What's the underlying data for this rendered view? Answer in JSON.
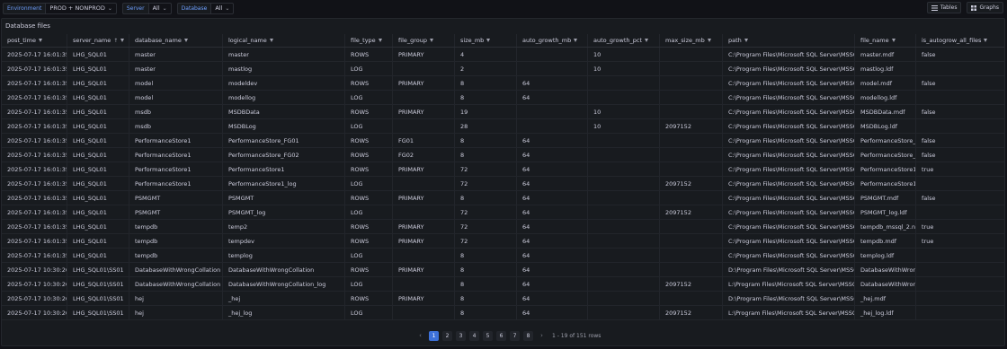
{
  "variables": [
    {
      "label": "Environment",
      "value": "PROD + NONPROD",
      "chevron": true
    },
    {
      "label": "Server",
      "value": "All",
      "chevron": true
    },
    {
      "label": "Database",
      "value": "All",
      "chevron": true
    }
  ],
  "toolbar_buttons": [
    {
      "label": "Tables",
      "icon": "list-icon"
    },
    {
      "label": "Graphs",
      "icon": "grid-icon"
    }
  ],
  "panel": {
    "title": "Database files"
  },
  "table": {
    "columns": [
      "post_time",
      "server_name",
      "database_name",
      "logical_name",
      "file_type",
      "file_group",
      "size_mb",
      "auto_growth_mb",
      "auto_growth_pct",
      "max_size_mb",
      "path",
      "file_name",
      "is_autogrow_all_files"
    ],
    "sorted_column": "server_name",
    "sort_direction": "asc",
    "rows": [
      [
        "2025-07-17 16:01:35",
        "LHG_SQL01",
        "master",
        "master",
        "ROWS",
        "PRIMARY",
        "4",
        "",
        "10",
        "",
        "C:\\Program Files\\Microsoft SQL Server\\MSSQL1!",
        "master.mdf",
        "false"
      ],
      [
        "2025-07-17 16:01:35",
        "LHG_SQL01",
        "master",
        "mastlog",
        "LOG",
        "",
        "2",
        "",
        "10",
        "",
        "C:\\Program Files\\Microsoft SQL Server\\MSSQL1!",
        "mastlog.ldf",
        ""
      ],
      [
        "2025-07-17 16:01:35",
        "LHG_SQL01",
        "model",
        "modeldev",
        "ROWS",
        "PRIMARY",
        "8",
        "64",
        "",
        "",
        "C:\\Program Files\\Microsoft SQL Server\\MSSQL1!",
        "model.mdf",
        "false"
      ],
      [
        "2025-07-17 16:01:35",
        "LHG_SQL01",
        "model",
        "modellog",
        "LOG",
        "",
        "8",
        "64",
        "",
        "",
        "C:\\Program Files\\Microsoft SQL Server\\MSSQL1!",
        "modellog.ldf",
        ""
      ],
      [
        "2025-07-17 16:01:35",
        "LHG_SQL01",
        "msdb",
        "MSDBData",
        "ROWS",
        "PRIMARY",
        "19",
        "",
        "10",
        "",
        "C:\\Program Files\\Microsoft SQL Server\\MSSQL1!",
        "MSDBData.mdf",
        "false"
      ],
      [
        "2025-07-17 16:01:35",
        "LHG_SQL01",
        "msdb",
        "MSDBLog",
        "LOG",
        "",
        "28",
        "",
        "10",
        "2097152",
        "C:\\Program Files\\Microsoft SQL Server\\MSSQL1!",
        "MSDBLog.ldf",
        ""
      ],
      [
        "2025-07-17 16:01:35",
        "LHG_SQL01",
        "PerformanceStore1",
        "PerformanceStore_FG01",
        "ROWS",
        "FG01",
        "8",
        "64",
        "",
        "",
        "C:\\Program Files\\Microsoft SQL Server\\MSSQL1!",
        "PerformanceStore_FG",
        "false"
      ],
      [
        "2025-07-17 16:01:35",
        "LHG_SQL01",
        "PerformanceStore1",
        "PerformanceStore_FG02",
        "ROWS",
        "FG02",
        "8",
        "64",
        "",
        "",
        "C:\\Program Files\\Microsoft SQL Server\\MSSQL1!",
        "PerformanceStore_FG",
        "false"
      ],
      [
        "2025-07-17 16:01:35",
        "LHG_SQL01",
        "PerformanceStore1",
        "PerformanceStore1",
        "ROWS",
        "PRIMARY",
        "72",
        "64",
        "",
        "",
        "C:\\Program Files\\Microsoft SQL Server\\MSSQL1!",
        "PerformanceStore1.m",
        "true"
      ],
      [
        "2025-07-17 16:01:35",
        "LHG_SQL01",
        "PerformanceStore1",
        "PerformanceStore1_log",
        "LOG",
        "",
        "72",
        "64",
        "",
        "2097152",
        "C:\\Program Files\\Microsoft SQL Server\\MSSQL1!",
        "PerformanceStore1_lo",
        ""
      ],
      [
        "2025-07-17 16:01:35",
        "LHG_SQL01",
        "PSMGMT",
        "PSMGMT",
        "ROWS",
        "PRIMARY",
        "8",
        "64",
        "",
        "",
        "C:\\Program Files\\Microsoft SQL Server\\MSSQL1!",
        "PSMGMT.mdf",
        "false"
      ],
      [
        "2025-07-17 16:01:35",
        "LHG_SQL01",
        "PSMGMT",
        "PSMGMT_log",
        "LOG",
        "",
        "72",
        "64",
        "",
        "2097152",
        "C:\\Program Files\\Microsoft SQL Server\\MSSQL1!",
        "PSMGMT_log.ldf",
        ""
      ],
      [
        "2025-07-17 16:01:35",
        "LHG_SQL01",
        "tempdb",
        "temp2",
        "ROWS",
        "PRIMARY",
        "72",
        "64",
        "",
        "",
        "C:\\Program Files\\Microsoft SQL Server\\MSSQL1!",
        "tempdb_mssql_2.ndf",
        "true"
      ],
      [
        "2025-07-17 16:01:35",
        "LHG_SQL01",
        "tempdb",
        "tempdev",
        "ROWS",
        "PRIMARY",
        "72",
        "64",
        "",
        "",
        "C:\\Program Files\\Microsoft SQL Server\\MSSQL1!",
        "tempdb.mdf",
        "true"
      ],
      [
        "2025-07-17 16:01:35",
        "LHG_SQL01",
        "tempdb",
        "templog",
        "LOG",
        "",
        "8",
        "64",
        "",
        "",
        "C:\\Program Files\\Microsoft SQL Server\\MSSQL1!",
        "templog.ldf",
        ""
      ],
      [
        "2025-07-17 10:30:26",
        "LHG_SQL01\\SS01",
        "DatabaseWithWrongCollation",
        "DatabaseWithWrongCollation",
        "ROWS",
        "PRIMARY",
        "8",
        "64",
        "",
        "",
        "D:\\Program Files\\Microsoft SQL Server\\MSSQL1!",
        "DatabaseWithWrongC",
        ""
      ],
      [
        "2025-07-17 10:30:26",
        "LHG_SQL01\\SS01",
        "DatabaseWithWrongCollation",
        "DatabaseWithWrongCollation_log",
        "LOG",
        "",
        "8",
        "64",
        "",
        "2097152",
        "L:\\Program Files\\Microsoft SQL Server\\MSSQL1!",
        "DatabaseWithWrongCo",
        ""
      ],
      [
        "2025-07-17 10:30:26",
        "LHG_SQL01\\SS01",
        "hej",
        "_hej",
        "ROWS",
        "PRIMARY",
        "8",
        "64",
        "",
        "",
        "D:\\Program Files\\Microsoft SQL Server\\MSSQL1!",
        "_hej.mdf",
        ""
      ],
      [
        "2025-07-17 10:30:26",
        "LHG_SQL01\\SS01",
        "hej",
        "_hej_log",
        "LOG",
        "",
        "8",
        "64",
        "",
        "2097152",
        "L:\\Program Files\\Microsoft SQL Server\\MSSQL1!",
        "_hej_log.ldf",
        ""
      ]
    ]
  },
  "pagination": {
    "pages": [
      "1",
      "2",
      "3",
      "4",
      "5",
      "6",
      "7",
      "8"
    ],
    "current": "1",
    "info": "1 - 19 of 151 rows"
  },
  "colors": {
    "accent": "#3d71d9",
    "background": "#111217",
    "panel": "#181b1f"
  }
}
